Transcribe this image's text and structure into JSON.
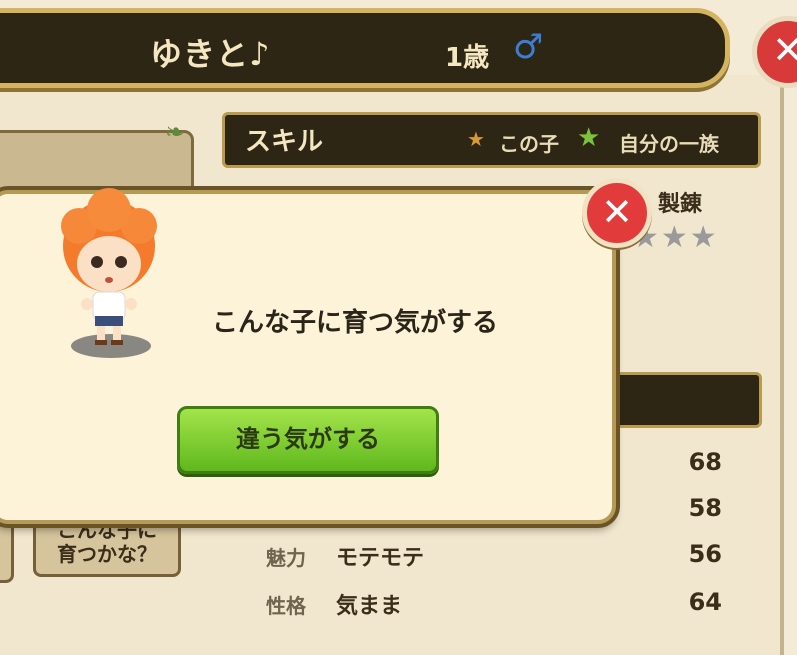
{
  "header": {
    "name": "ゆきと♪",
    "age": "1歳",
    "gender_symbol": "♂"
  },
  "icons": {
    "top_close": "close-icon",
    "popup_close": "close-icon",
    "leaf": "leaf-icon",
    "star": "star-icon"
  },
  "skill": {
    "title": "スキル",
    "legend_this_star": "★",
    "legend_this": "この子",
    "legend_clan_star": "★",
    "legend_clan": "自分の一族",
    "make_label": "製錬",
    "stars": "★★★"
  },
  "stats": [
    {
      "label": "",
      "value": "",
      "num": "68"
    },
    {
      "label": "",
      "value": "",
      "num": "58"
    },
    {
      "label": "魅力",
      "value": "モテモテ",
      "num": "56"
    },
    {
      "label": "性格",
      "value": "気まま",
      "num": "64"
    }
  ],
  "grow_button": {
    "line1": "こんな子に",
    "line2": "育つかな？"
  },
  "popup": {
    "message": "こんな子に育つ気がする",
    "confirm_label": "違う気がする"
  },
  "colors": {
    "header_bg": "#2e2615",
    "accent_gold": "#d4b45e",
    "confirm_green": "#6cc322",
    "close_red": "#e23b3b",
    "gender_blue": "#3a7fd1"
  }
}
